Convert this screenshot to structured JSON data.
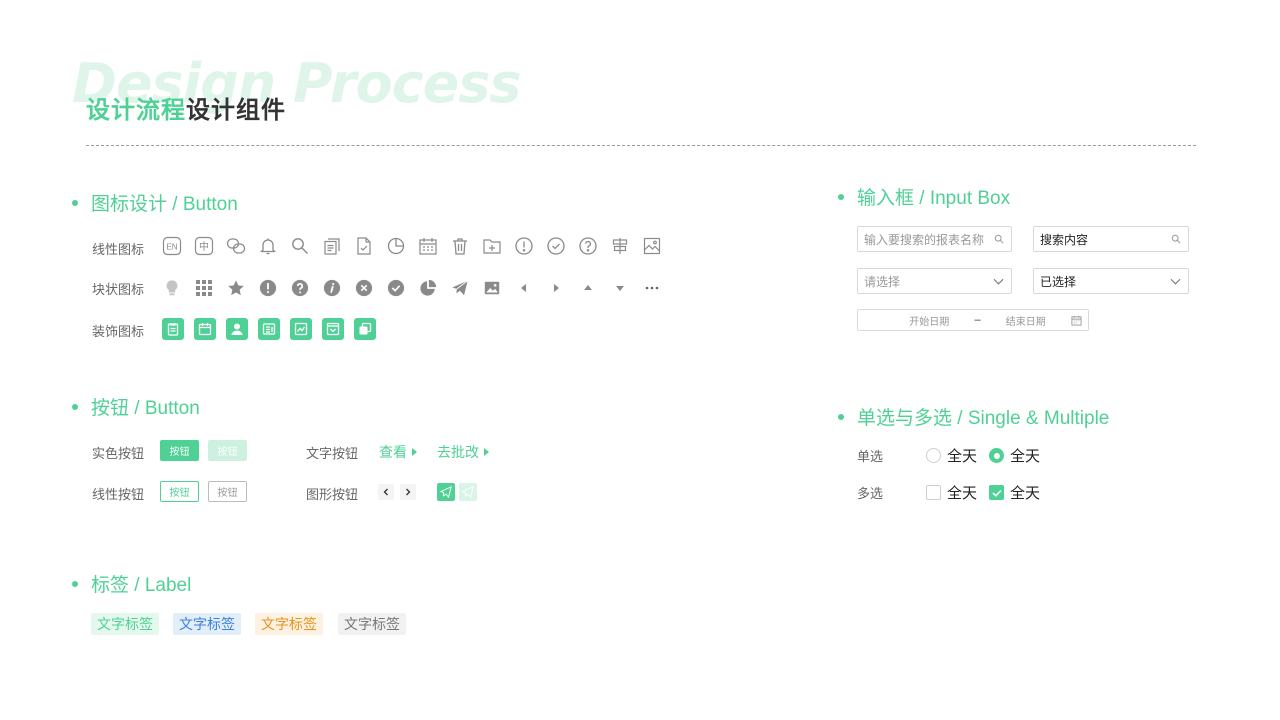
{
  "header": {
    "bg_title": "Design Process",
    "title_accent": "设计流程",
    "title_main": "设计组件"
  },
  "colors": {
    "accent": "#4fd195",
    "tag_green_bg": "#e4f8ee",
    "tag_blue_bg": "#e3eefb",
    "tag_blue_text": "#3d7fd9",
    "tag_orange_bg": "#fdf1e1",
    "tag_orange_text": "#e8931f",
    "tag_gray_bg": "#f1f1f1",
    "tag_gray_text": "#777777"
  },
  "icons_section": {
    "title": "图标设计 / Button",
    "line_label": "线性图标",
    "block_label": "块状图标",
    "deco_label": "装饰图标",
    "line_icons": [
      "en-icon",
      "zhong-icon",
      "link-icon",
      "bell-icon",
      "search-icon",
      "document-icon",
      "file-check-icon",
      "pie-chart-icon",
      "calendar-icon",
      "trash-icon",
      "folder-add-icon",
      "alert-circle-icon",
      "check-circle-icon",
      "question-circle-icon",
      "signpost-icon",
      "image-icon"
    ],
    "block_icons": [
      "bulb-icon",
      "grid-icon",
      "star-icon",
      "alert-filled-icon",
      "question-filled-icon",
      "info-filled-icon",
      "close-filled-icon",
      "check-filled-icon",
      "pie-filled-icon",
      "send-icon",
      "image-filled-icon",
      "caret-left-icon",
      "caret-right-icon",
      "caret-up-icon",
      "caret-down-icon",
      "more-icon"
    ],
    "deco_icons": [
      "clipboard-icon",
      "calendar-icon",
      "user-icon",
      "news-icon",
      "chart-icon",
      "inbox-icon",
      "copy-icon"
    ],
    "en_text": "EN",
    "zhong_text": "中"
  },
  "buttons_section": {
    "title": "按钮 / Button",
    "solid_label": "实色按钮",
    "line_label": "线性按钮",
    "text_label": "文字按钮",
    "icon_label": "图形按钮",
    "button_text": "按钮",
    "text_btn_1": "查看",
    "text_btn_2": "去批改"
  },
  "tags_section": {
    "title": "标签 / Label",
    "tags": [
      "文字标签",
      "文字标签",
      "文字标签",
      "文字标签"
    ]
  },
  "input_section": {
    "title": "输入框 / Input Box",
    "search_placeholder": "输入要搜索的报表名称",
    "search_value": "搜索内容",
    "select_placeholder": "请选择",
    "select_value": "已选择",
    "date_start": "开始日期",
    "date_sep": "–",
    "date_end": "结束日期"
  },
  "choice_section": {
    "title": "单选与多选 / Single & Multiple",
    "single_label": "单选",
    "multi_label": "多选",
    "option_text": "全天"
  }
}
